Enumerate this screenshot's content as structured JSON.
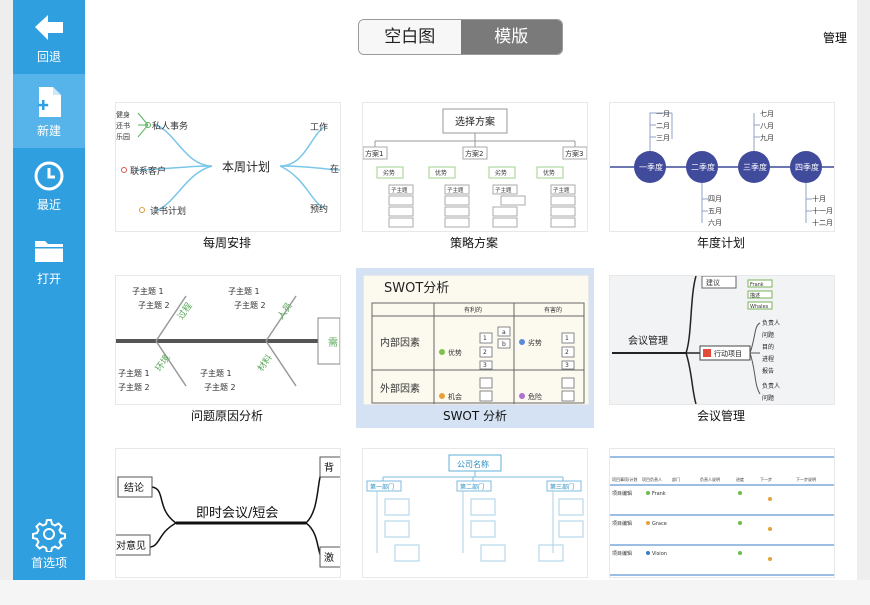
{
  "sidebar": {
    "items": [
      {
        "label": "回退",
        "icon": "back-arrow-icon"
      },
      {
        "label": "新建",
        "icon": "new-file-icon"
      },
      {
        "label": "最近",
        "icon": "clock-icon"
      },
      {
        "label": "打开",
        "icon": "folder-icon"
      },
      {
        "label": "首选项",
        "icon": "gear-icon"
      }
    ]
  },
  "header": {
    "tabs": [
      {
        "label": "空白图"
      },
      {
        "label": "模版"
      }
    ],
    "manage_label": "管理"
  },
  "templates": [
    {
      "caption": "每周安排",
      "thumb": {
        "center": "本周计划",
        "nodes": [
          "私人事务",
          "联系客户",
          "读书计划",
          "工作",
          "在",
          "预约"
        ],
        "cut": [
          "健身",
          "还书",
          "乐园"
        ]
      }
    },
    {
      "caption": "策略方案",
      "thumb": {
        "root": "选择方案",
        "plans": [
          "方案1",
          "方案2",
          "方案3"
        ],
        "tags": [
          "劣势",
          "优势",
          "劣势",
          "优势"
        ],
        "sub": "子主题"
      }
    },
    {
      "caption": "年度计划",
      "thumb": {
        "quarters": [
          "一季度",
          "二季度",
          "三季度",
          "四季度"
        ],
        "months_top": [
          "一月",
          "二月",
          "三月",
          "七月",
          "八月",
          "九月"
        ],
        "months_bottom": [
          "四月",
          "五月",
          "六月",
          "十月",
          "十一月",
          "十二月"
        ]
      }
    },
    {
      "caption": "问题原因分析",
      "thumb": {
        "sub1": "子主题 1",
        "sub2": "子主题 2",
        "bones": [
          "过程",
          "人员",
          "环境",
          "材料"
        ],
        "head": "需"
      }
    },
    {
      "caption": "SWOT 分析",
      "thumb": {
        "title": "SWOT分析",
        "cols": [
          "有利的",
          "有害的"
        ],
        "rows": [
          "内部因素",
          "外部因素"
        ],
        "cells": [
          "优势",
          "劣势",
          "机会",
          "危险"
        ],
        "nums": [
          "1",
          "2",
          "3",
          "a",
          "b"
        ]
      }
    },
    {
      "caption": "会议管理",
      "thumb": {
        "center": "会议管理",
        "branch1": "建议",
        "branch2": "行动项目",
        "sub1": [
          "Frank",
          "描述",
          "Whales"
        ],
        "sub2": [
          "负责人",
          "问题",
          "目的",
          "进程",
          "报告",
          "负责人",
          "问题"
        ]
      }
    },
    {
      "caption": "",
      "thumb": {
        "center": "即时会议/短会",
        "nodes": [
          "结论",
          "对意见",
          "背",
          "激"
        ]
      }
    },
    {
      "caption": "",
      "thumb": {
        "root": "公司名称",
        "depts": [
          "第一部门",
          "第二部门",
          "第三部门"
        ]
      }
    },
    {
      "caption": "",
      "thumb": {
        "headers": [
          "项目事项/计划",
          "项目负责人",
          "部门",
          "负责人说明",
          "进度",
          "下一步",
          "下一步说明"
        ],
        "row_label": "项目编辑",
        "owners": [
          "Frank",
          "Grace",
          "Vision"
        ]
      }
    }
  ]
}
